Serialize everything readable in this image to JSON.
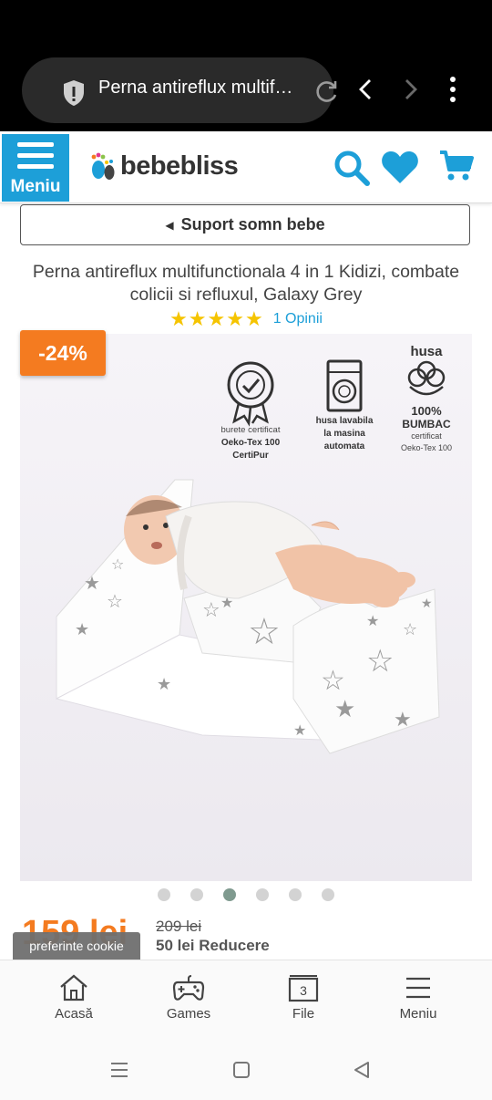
{
  "browser": {
    "url_title": "Perna antireflux multifunctionala 4 in 1 Kidizi"
  },
  "header": {
    "menu_label": "Meniu",
    "logo_text": "bebebliss",
    "brand_color": "#1d9fd8"
  },
  "breadcrumb": {
    "label": "Suport somn bebe"
  },
  "product": {
    "title": "Perna antireflux multifunctionala 4 in 1 Kidizi, combate colicii si refluxul, Galaxy Grey",
    "rating_stars": 5,
    "reviews_text": "1 Opinii",
    "discount_badge": "-24%",
    "image_labels": {
      "cert_label_1": "burete certificat",
      "cert_label_2": "Oeko-Tex 100",
      "cert_label_3": "CertiPur",
      "wash_label_1": "husa lavabila",
      "wash_label_2": "la masina",
      "wash_label_3": "automata",
      "husa_title": "husa",
      "cotton_1": "100%",
      "cotton_2": "BUMBAC",
      "cotton_3": "certificat",
      "cotton_4": "Oeko-Tex 100"
    },
    "gallery": {
      "count": 6,
      "active_index": 2
    },
    "price": "159 lei",
    "old_price": "209 lei",
    "discount_text": "50 lei Reducere"
  },
  "cookie": {
    "label": "preferinte cookie"
  },
  "bottom_nav": {
    "home": "Acasă",
    "games": "Games",
    "files": "File",
    "files_count": "3",
    "menu": "Meniu"
  }
}
